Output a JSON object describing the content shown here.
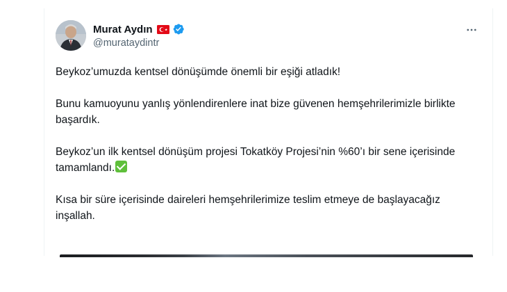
{
  "author": {
    "display_name": "Murat Aydın",
    "handle": "@murataydintr",
    "flag_icon": "turkey-flag-icon",
    "verified_icon": "verified-badge-icon",
    "verified_color": "#1d9bf0"
  },
  "tweet": {
    "paragraphs": [
      "Beykoz’umuzda kentsel dönüşümde önemli bir eşiği atladık!",
      "Bunu kamuoyunu yanlış yönlendirenlere inat bize güvenen hemşehrilerimizle birlikte başardık.",
      "Beykoz’un ilk kentsel dönüşüm projesi Tokatköy Projesi’nin %60’ı bir sene içerisinde tamamlandı.",
      "Kısa bir süre içerisinde daireleri hemşehrilerimize teslim etmeye de başlayacağız inşallah."
    ],
    "emoji": "check-mark-button-icon"
  },
  "more_icon": "more-horizontal-icon"
}
